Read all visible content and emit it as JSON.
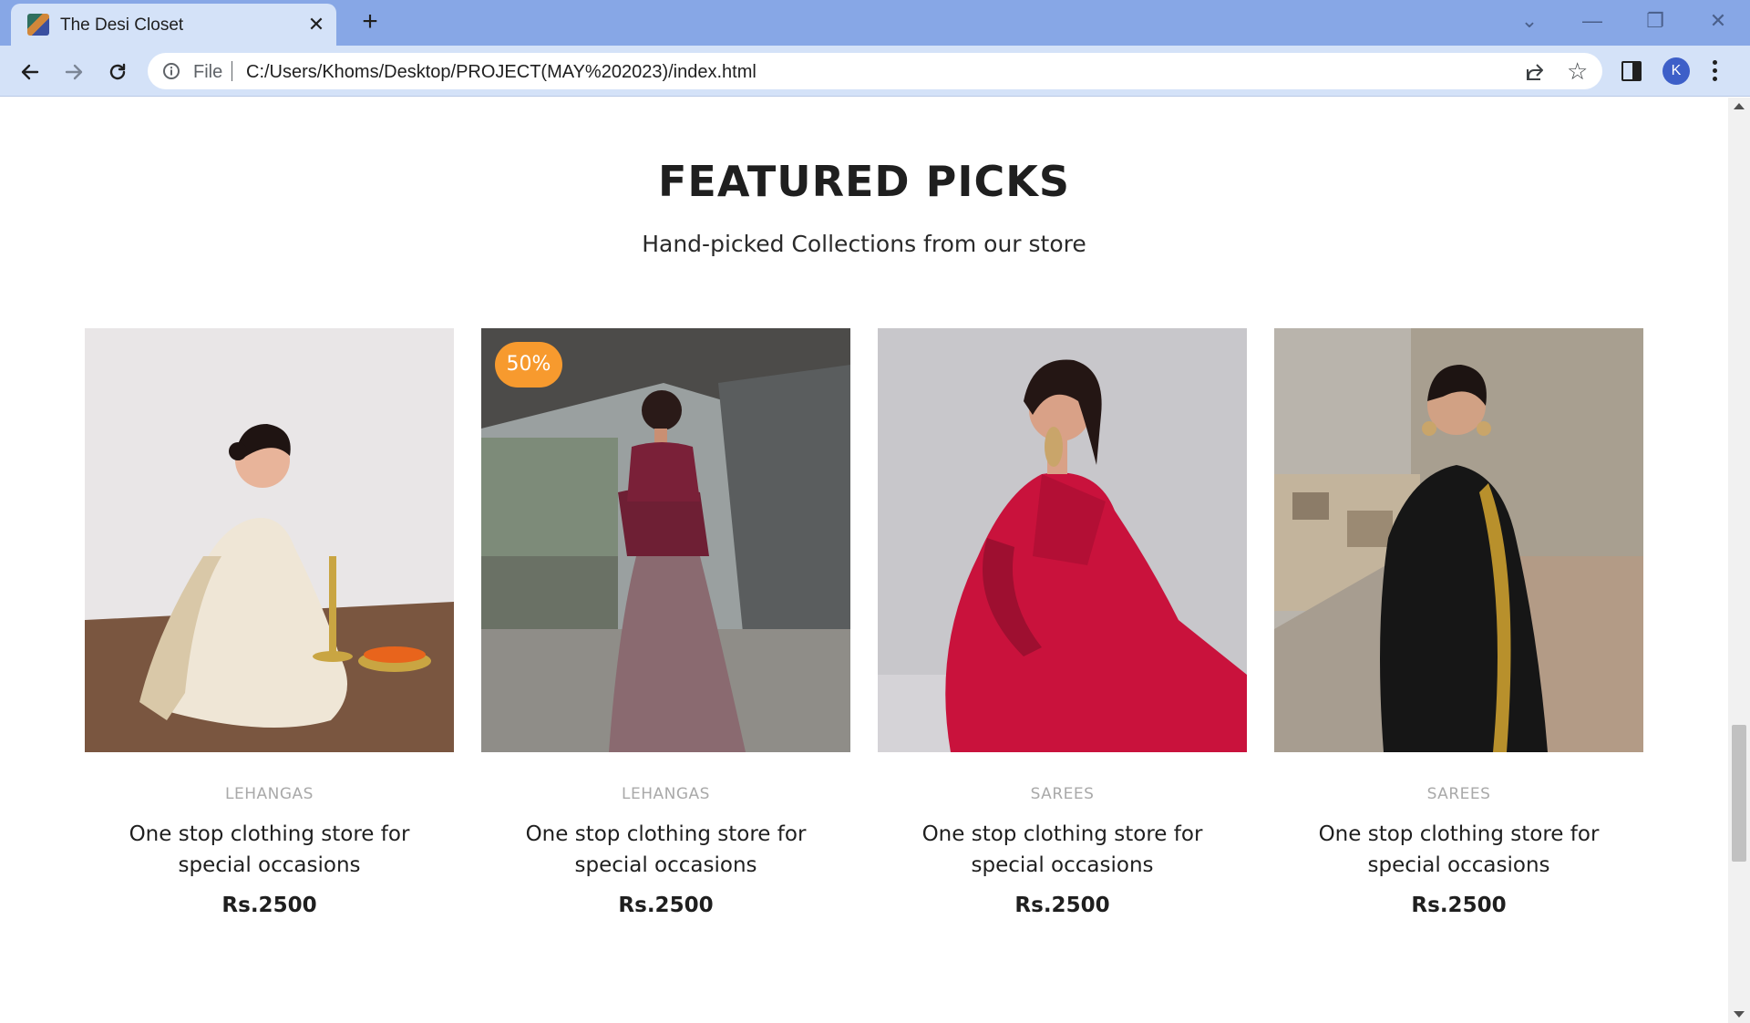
{
  "browser": {
    "tab_title": "The Desi Closet",
    "tab_close": "✕",
    "new_tab": "+",
    "file_label": "File",
    "url": "C:/Users/Khoms/Desktop/PROJECT(MAY%202023)/index.html",
    "profile_initial": "K",
    "window_controls": {
      "tab_search": "⌄",
      "minimize": "—",
      "restore": "❐",
      "close": "✕"
    }
  },
  "section": {
    "title": "FEATURED PICKS",
    "subtitle": "Hand-picked Collections from our store"
  },
  "products": [
    {
      "category": "LEHANGAS",
      "name": "One stop clothing store for special occasions",
      "price": "Rs.2500",
      "image": "woman-in-cream-kerala-saree-with-lamp"
    },
    {
      "category": "LEHANGAS",
      "name": "One stop clothing store for special occasions",
      "price": "Rs.2500",
      "badge": "50%",
      "image": "woman-in-mauve-lehenga-back-view"
    },
    {
      "category": "SAREES",
      "name": "One stop clothing store for special occasions",
      "price": "Rs.2500",
      "image": "woman-in-red-saree-seated"
    },
    {
      "category": "SAREES",
      "name": "One stop clothing store for special occasions",
      "price": "Rs.2500",
      "image": "woman-in-black-saree-on-rooftop"
    }
  ],
  "colors": {
    "titlebar": "#87a7e6",
    "toolbar": "#d4e2f8",
    "badge": "#f79a2e",
    "category_text": "#a9a9a9"
  }
}
